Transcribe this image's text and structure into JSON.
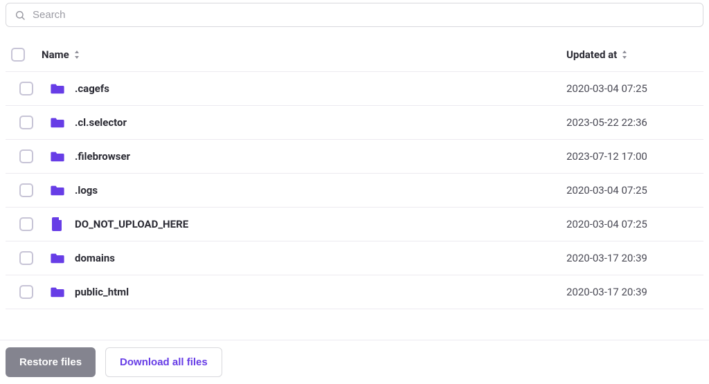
{
  "search": {
    "placeholder": "Search",
    "value": ""
  },
  "columns": {
    "name": "Name",
    "updated_at": "Updated at"
  },
  "rows": [
    {
      "type": "folder",
      "name": ".cagefs",
      "updated_at": "2020-03-04 07:25"
    },
    {
      "type": "folder",
      "name": ".cl.selector",
      "updated_at": "2023-05-22 22:36"
    },
    {
      "type": "folder",
      "name": ".filebrowser",
      "updated_at": "2023-07-12 17:00"
    },
    {
      "type": "folder",
      "name": ".logs",
      "updated_at": "2020-03-04 07:25"
    },
    {
      "type": "file",
      "name": "DO_NOT_UPLOAD_HERE",
      "updated_at": "2020-03-04 07:25"
    },
    {
      "type": "folder",
      "name": "domains",
      "updated_at": "2020-03-17 20:39"
    },
    {
      "type": "folder",
      "name": "public_html",
      "updated_at": "2020-03-17 20:39"
    }
  ],
  "footer": {
    "restore_label": "Restore files",
    "download_label": "Download all files"
  },
  "colors": {
    "accent": "#673de6"
  }
}
